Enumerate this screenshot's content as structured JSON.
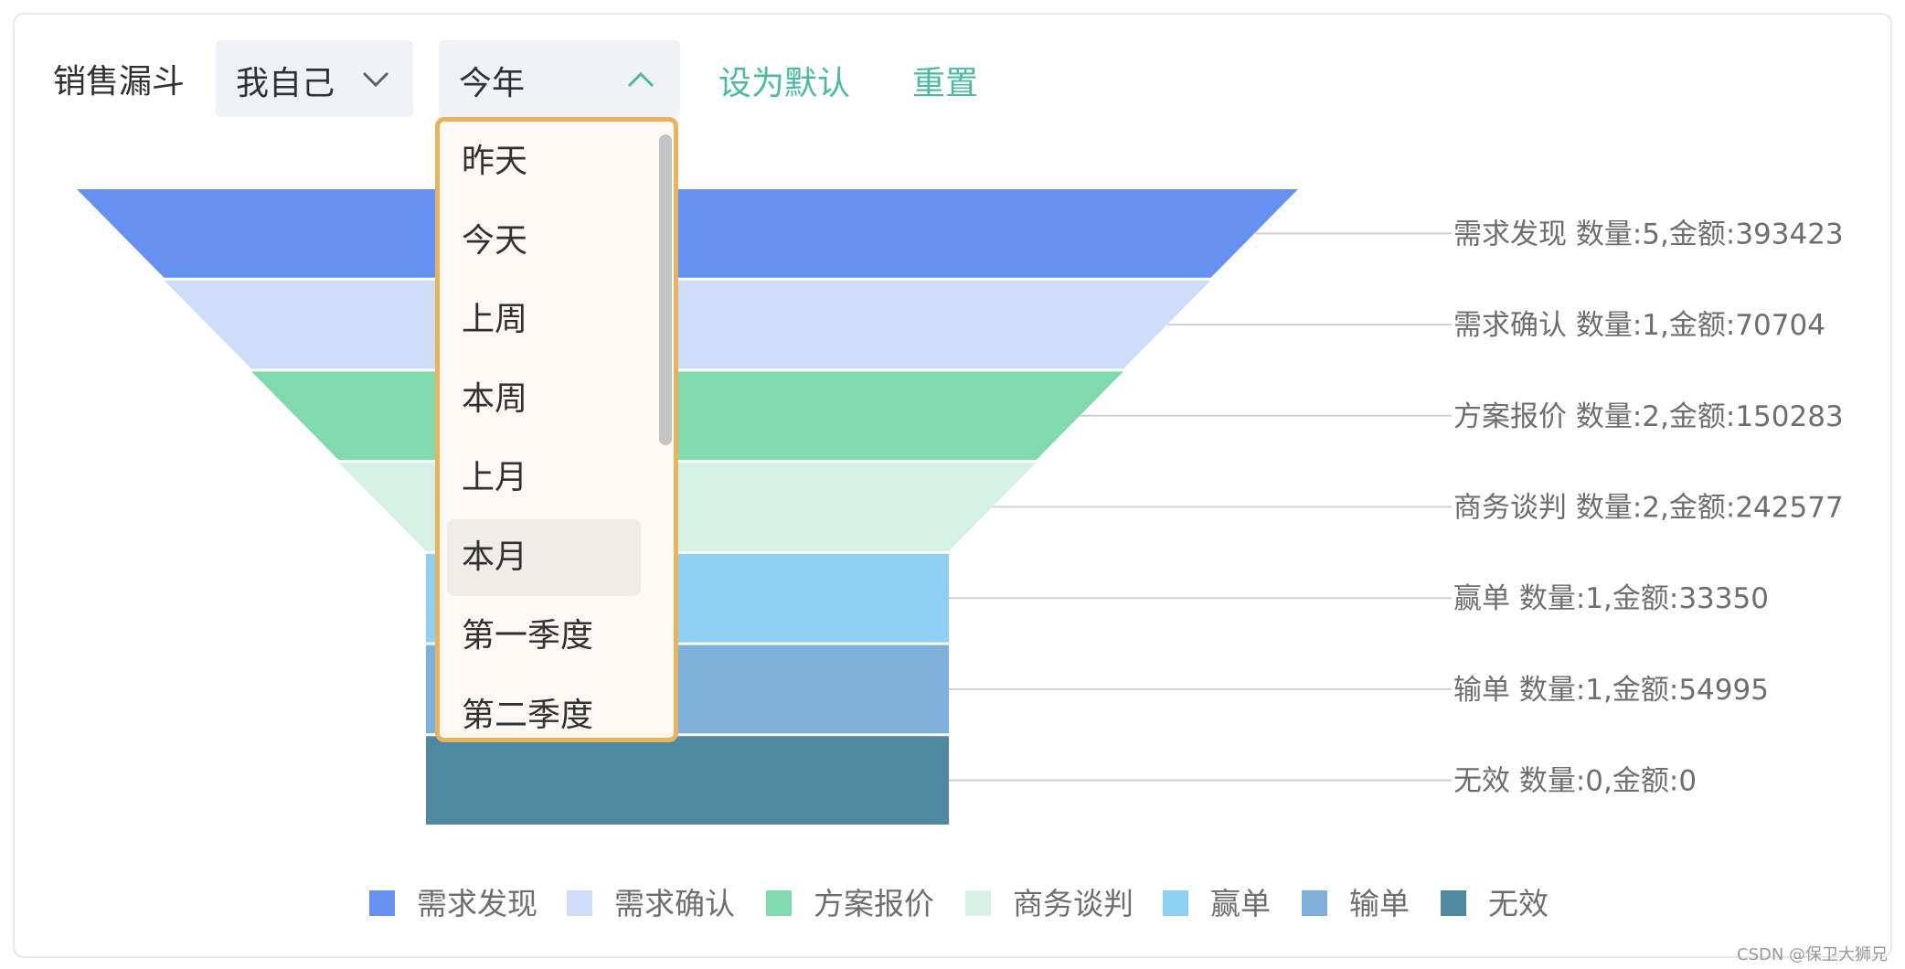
{
  "toolbar": {
    "title": "销售漏斗",
    "owner_select": {
      "value": "我自己",
      "icon": "chevron-down-icon"
    },
    "period_select": {
      "value": "今年",
      "icon": "chevron-up-icon"
    },
    "set_default_label": "设为默认",
    "reset_label": "重置"
  },
  "dropdown": {
    "items": [
      "昨天",
      "今天",
      "上周",
      "本周",
      "上月",
      "本月",
      "第一季度",
      "第二季度"
    ],
    "hovered_item": "本月"
  },
  "colors": {
    "accent": "#4fb8a3",
    "dropdown_border": "#e8b25e"
  },
  "chart_data": {
    "type": "funnel",
    "title": "",
    "legend_position": "bottom",
    "series": [
      {
        "name": "需求发现",
        "label": "需求发现 数量:5,金额:393423",
        "count": 5,
        "amount": 393423,
        "color": "#6592f2"
      },
      {
        "name": "需求确认",
        "label": "需求确认 数量:1,金额:70704",
        "count": 1,
        "amount": 70704,
        "color": "#cfdcf8"
      },
      {
        "name": "方案报价",
        "label": "方案报价 数量:2,金额:150283",
        "count": 2,
        "amount": 150283,
        "color": "#82d9ad"
      },
      {
        "name": "商务谈判",
        "label": "商务谈判 数量:2,金额:242577",
        "count": 2,
        "amount": 242577,
        "color": "#d5f1e4"
      },
      {
        "name": "赢单",
        "label": "赢单 数量:1,金额:33350",
        "count": 1,
        "amount": 33350,
        "color": "#8fd0f2"
      },
      {
        "name": "输单",
        "label": "输单 数量:1,金额:54995",
        "count": 1,
        "amount": 54995,
        "color": "#7fb0dc"
      },
      {
        "name": "无效",
        "label": "无效 数量:0,金额:0",
        "count": 0,
        "amount": 0,
        "color": "#4e89a0"
      }
    ]
  },
  "watermark": "CSDN @保卫大狮兄"
}
